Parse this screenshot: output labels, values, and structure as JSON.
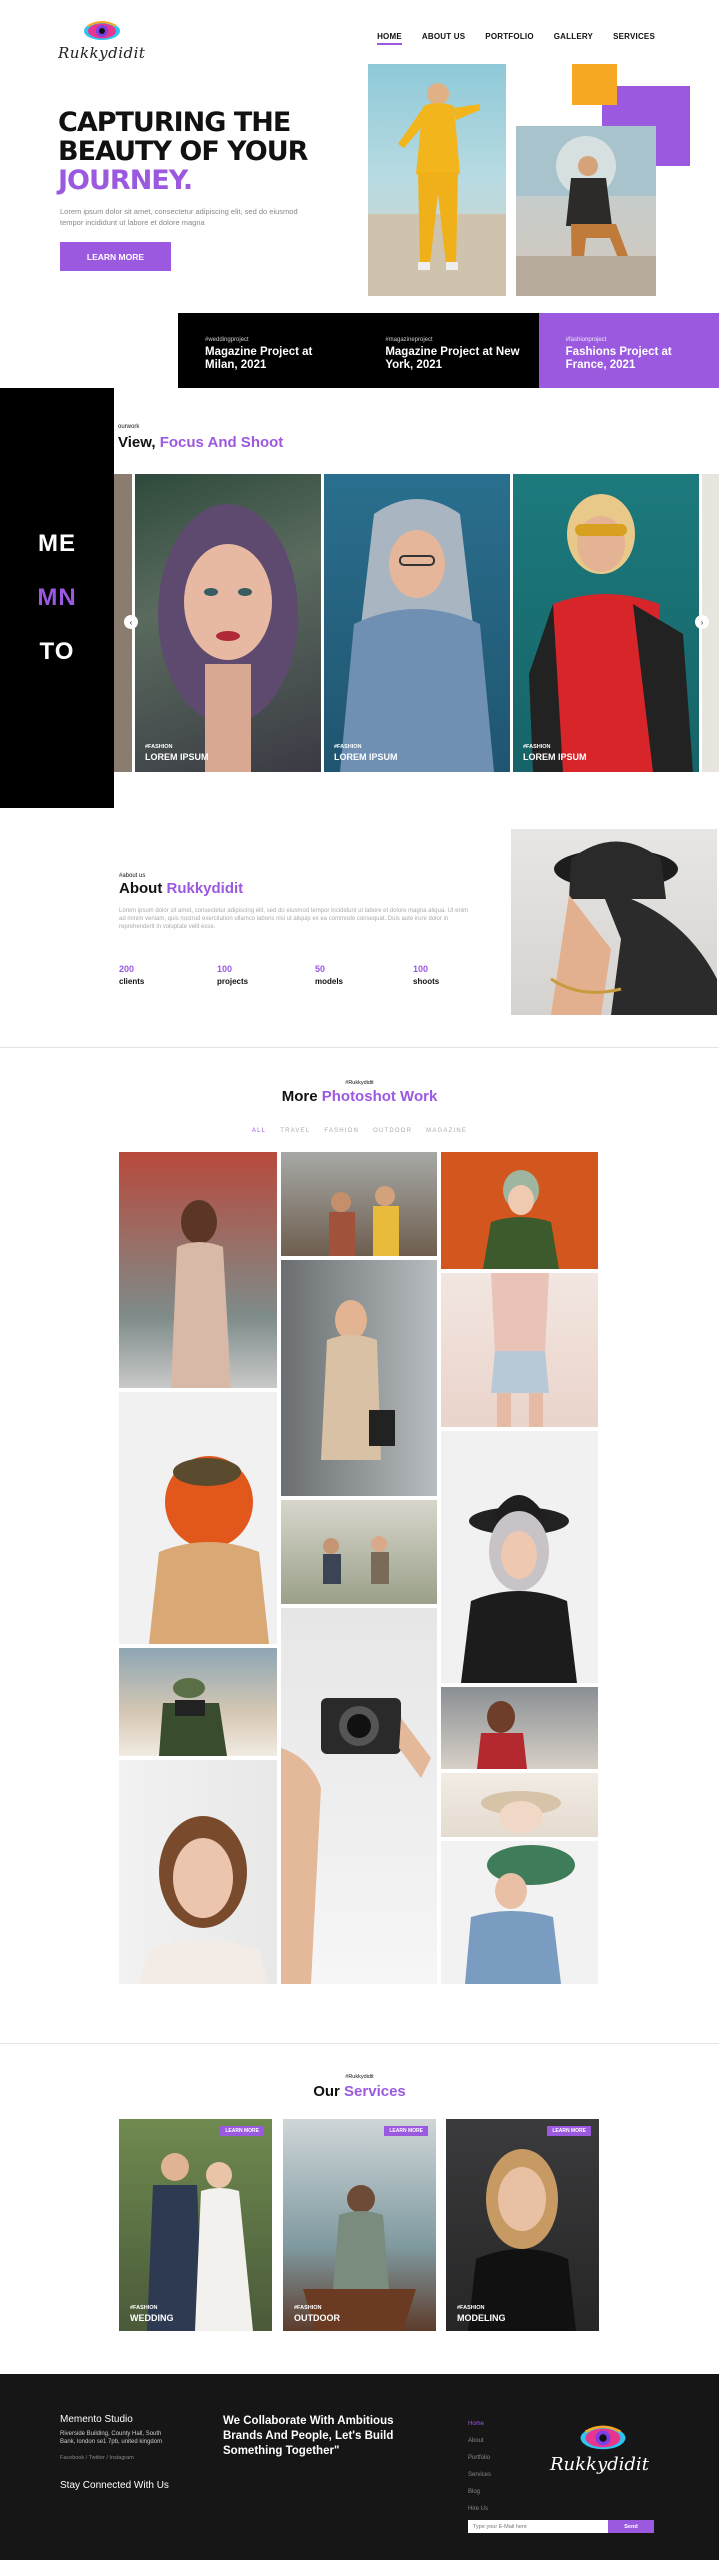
{
  "brand": {
    "name": "Rukkydidit"
  },
  "nav": [
    {
      "label": "HOME",
      "active": true
    },
    {
      "label": "ABOUT US"
    },
    {
      "label": "PORTFOLIO"
    },
    {
      "label": "GALLERY"
    },
    {
      "label": "SERVICES"
    }
  ],
  "hero": {
    "title_line1": "CAPTURING THE",
    "title_line2": "BEAUTY OF YOUR",
    "title_line3": "JOURNEY.",
    "subtitle": "Lorem ipsum dolor sit amet, consectetur adipiscing elit, sed do eiusmod tempor incididunt ut labore et dolore magna",
    "button": "LEARN MORE"
  },
  "projects": [
    {
      "tag": "#weddingproject",
      "title": "Magazine Project at Milan, 2021"
    },
    {
      "tag": "#magazineproject",
      "title": "Magazine Project at New York, 2021"
    },
    {
      "tag": "#fashionproject",
      "title": "Fashions Project at France, 2021"
    }
  ],
  "side_block": [
    "ME",
    "MN",
    "TO"
  ],
  "view": {
    "tag": "ourwork",
    "title_a": "View, ",
    "title_b": "Focus And Shoot"
  },
  "gallery_cards": [
    {
      "tag": "#FASHION",
      "label": "LOREM IPSUM"
    },
    {
      "tag": "#FASHION",
      "label": "LOREM IPSUM"
    },
    {
      "tag": "#FASHION",
      "label": "LOREM IPSUM"
    }
  ],
  "about": {
    "tag": "#about us",
    "title_a": "About ",
    "title_b": "Rukkydidit",
    "text": "Lorem ipsum dolor sit amet, consectetur adipiscing elit, sed do eiusmod tempor incididunt ut labore et dolore magna aliqua. Ut enim ad minim veniam, quis nostrud exercitation ullamco laboris nisi ut aliquip ex ea commodo consequat. Duis aute irure dolor in reprehenderit in voluptate velit esse.",
    "stats": [
      {
        "value": "200",
        "label": "clients"
      },
      {
        "value": "100",
        "label": "projects"
      },
      {
        "value": "50",
        "label": "models"
      },
      {
        "value": "100",
        "label": "shoots"
      }
    ]
  },
  "more": {
    "tag": "#Rukkydidit",
    "title_a": "More ",
    "title_b": "Photoshot Work",
    "filters": [
      {
        "label": "ALL",
        "active": true
      },
      {
        "label": "TRAVEL"
      },
      {
        "label": "FASHION"
      },
      {
        "label": "OUTDOOR"
      },
      {
        "label": "MAGAZINE"
      }
    ]
  },
  "services": {
    "tag": "#Rukkydidit",
    "title_a": "Our ",
    "title_b": "Services",
    "items": [
      {
        "badge": "LEARN MORE",
        "tag": "#FASHION",
        "label": "WEDDING"
      },
      {
        "badge": "LEARN MORE",
        "tag": "#FASHION",
        "label": "OUTDOOR"
      },
      {
        "badge": "LEARN MORE",
        "tag": "#FASHION",
        "label": "MODELING"
      }
    ]
  },
  "footer": {
    "brand": "Memento Studio",
    "address": "Riverside Building, County Hall, South Bank, london se1 7pb, united kingdom",
    "social": "Facebook / Twitter / Instagram",
    "stay": "Stay Connected With Us",
    "collab": "We Collaborate With Ambitious Brands And People, Let's Build Something Together\"",
    "links": [
      {
        "label": "Home",
        "active": true
      },
      {
        "label": "About"
      },
      {
        "label": "Portfolio"
      },
      {
        "label": "Services"
      },
      {
        "label": "Blog"
      },
      {
        "label": "Hire Us"
      }
    ],
    "email_placeholder": "Type your E-Mail here",
    "send": "Send"
  },
  "colors": {
    "accent": "#9b59e0",
    "orange": "#f7a823",
    "dark": "#161616"
  }
}
